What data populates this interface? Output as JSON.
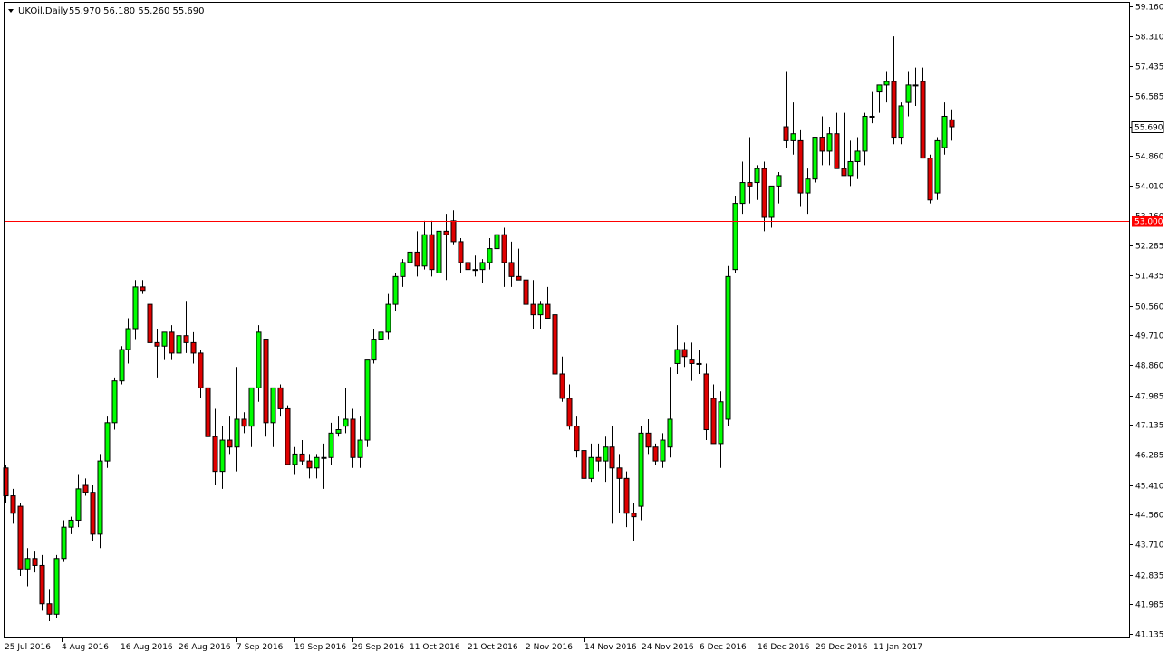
{
  "header": {
    "symbol": "UKOil,Daily",
    "ohlc": "55.970 56.180 55.260 55.690"
  },
  "colors": {
    "background": "#ffffff",
    "frame": "#000000",
    "bull": "#00ff00",
    "bear": "#e00000",
    "level_line": "#ff0000",
    "price_tag_current": "#ffffff",
    "price_tag_level": "#ff0000"
  },
  "chart_data": {
    "type": "candlestick",
    "y_range": [
      41.135,
      59.16
    ],
    "y_ticks": [
      "59.160",
      "58.310",
      "57.435",
      "56.585",
      "55.690",
      "54.860",
      "54.010",
      "53.160",
      "52.285",
      "51.435",
      "50.560",
      "49.710",
      "48.860",
      "47.985",
      "47.135",
      "46.285",
      "45.410",
      "44.560",
      "43.710",
      "42.835",
      "41.985",
      "41.135"
    ],
    "x_labels": [
      "25 Jul 2016",
      "4 Aug 2016",
      "16 Aug 2016",
      "26 Aug 2016",
      "7 Sep 2016",
      "19 Sep 2016",
      "29 Sep 2016",
      "11 Oct 2016",
      "21 Oct 2016",
      "2 Nov 2016",
      "14 Nov 2016",
      "24 Nov 2016",
      "6 Dec 2016",
      "16 Dec 2016",
      "29 Dec 2016",
      "11 Jan 2017"
    ],
    "current_price": "55.690",
    "horizontal_line": "53.000",
    "candles": [
      [
        45.9,
        46.0,
        44.9,
        45.1
      ],
      [
        45.1,
        45.3,
        44.3,
        44.6
      ],
      [
        44.8,
        44.9,
        42.8,
        43.0
      ],
      [
        43.0,
        43.6,
        42.5,
        43.3
      ],
      [
        43.3,
        43.5,
        42.9,
        43.1
      ],
      [
        43.1,
        43.4,
        41.8,
        42.0
      ],
      [
        42.0,
        42.4,
        41.5,
        41.7
      ],
      [
        41.7,
        43.4,
        41.6,
        43.3
      ],
      [
        43.3,
        44.4,
        43.2,
        44.2
      ],
      [
        44.2,
        44.5,
        44.0,
        44.4
      ],
      [
        44.4,
        45.7,
        44.2,
        45.3
      ],
      [
        45.4,
        45.6,
        45.1,
        45.2
      ],
      [
        45.2,
        45.4,
        43.8,
        44.0
      ],
      [
        44.0,
        46.3,
        43.6,
        46.1
      ],
      [
        46.1,
        47.4,
        45.9,
        47.2
      ],
      [
        47.2,
        48.5,
        47.0,
        48.4
      ],
      [
        48.4,
        49.4,
        48.3,
        49.3
      ],
      [
        49.3,
        50.2,
        48.9,
        49.9
      ],
      [
        49.9,
        51.3,
        49.6,
        51.1
      ],
      [
        51.1,
        51.3,
        50.9,
        51.0
      ],
      [
        50.6,
        50.7,
        49.5,
        49.5
      ],
      [
        49.5,
        49.9,
        48.5,
        49.4
      ],
      [
        49.4,
        49.8,
        49.0,
        49.8
      ],
      [
        49.8,
        50.0,
        49.0,
        49.2
      ],
      [
        49.2,
        49.7,
        49.0,
        49.7
      ],
      [
        49.7,
        50.7,
        49.2,
        49.5
      ],
      [
        49.5,
        49.8,
        48.9,
        49.2
      ],
      [
        49.2,
        49.3,
        47.9,
        48.2
      ],
      [
        48.2,
        48.5,
        46.6,
        46.8
      ],
      [
        46.8,
        47.6,
        45.4,
        45.8
      ],
      [
        45.8,
        47.1,
        45.3,
        46.7
      ],
      [
        46.7,
        47.4,
        46.3,
        46.5
      ],
      [
        46.5,
        48.8,
        45.8,
        47.3
      ],
      [
        47.3,
        47.5,
        46.9,
        47.1
      ],
      [
        47.1,
        48.2,
        46.5,
        48.2
      ],
      [
        48.2,
        50.0,
        47.8,
        49.8
      ],
      [
        49.6,
        49.6,
        46.8,
        47.2
      ],
      [
        47.2,
        48.1,
        46.5,
        48.2
      ],
      [
        48.2,
        48.3,
        47.4,
        47.6
      ],
      [
        47.6,
        47.7,
        46.2,
        46.0
      ],
      [
        46.0,
        46.5,
        45.7,
        46.3
      ],
      [
        46.3,
        46.7,
        46.0,
        46.1
      ],
      [
        46.1,
        46.3,
        45.6,
        45.9
      ],
      [
        45.9,
        46.3,
        45.6,
        46.2
      ],
      [
        46.2,
        46.6,
        45.3,
        46.2
      ],
      [
        46.2,
        47.2,
        46.0,
        46.9
      ],
      [
        46.9,
        47.4,
        46.8,
        47.0
      ],
      [
        47.1,
        48.2,
        46.9,
        47.3
      ],
      [
        47.3,
        47.6,
        45.9,
        46.2
      ],
      [
        46.2,
        47.4,
        45.9,
        46.7
      ],
      [
        46.7,
        49.0,
        46.5,
        49.0
      ],
      [
        49.0,
        49.9,
        48.9,
        49.6
      ],
      [
        49.6,
        50.5,
        49.2,
        49.8
      ],
      [
        49.8,
        50.9,
        49.6,
        50.6
      ],
      [
        50.6,
        51.5,
        50.4,
        51.4
      ],
      [
        51.4,
        51.9,
        51.1,
        51.8
      ],
      [
        51.8,
        52.4,
        51.6,
        52.1
      ],
      [
        52.1,
        52.7,
        51.4,
        51.7
      ],
      [
        51.7,
        53.0,
        51.6,
        52.6
      ],
      [
        52.6,
        53.0,
        51.4,
        51.6
      ],
      [
        51.5,
        52.6,
        51.4,
        52.7
      ],
      [
        52.7,
        53.2,
        51.3,
        52.6
      ],
      [
        53.0,
        53.3,
        52.3,
        52.4
      ],
      [
        52.4,
        52.5,
        51.5,
        51.8
      ],
      [
        51.8,
        52.3,
        51.2,
        51.6
      ],
      [
        51.6,
        52.0,
        51.4,
        51.6
      ],
      [
        51.6,
        51.9,
        51.2,
        51.8
      ],
      [
        51.8,
        52.5,
        51.6,
        52.2
      ],
      [
        52.2,
        53.2,
        51.5,
        52.6
      ],
      [
        52.6,
        52.8,
        51.1,
        51.8
      ],
      [
        51.8,
        52.4,
        51.1,
        51.4
      ],
      [
        51.4,
        52.2,
        51.3,
        51.3
      ],
      [
        51.3,
        51.5,
        50.3,
        50.6
      ],
      [
        50.6,
        51.3,
        49.9,
        50.3
      ],
      [
        50.3,
        50.7,
        49.9,
        50.6
      ],
      [
        50.6,
        51.1,
        50.2,
        50.2
      ],
      [
        50.3,
        50.8,
        48.6,
        48.6
      ],
      [
        48.6,
        49.1,
        47.8,
        47.9
      ],
      [
        47.9,
        48.3,
        47.0,
        47.1
      ],
      [
        47.1,
        47.4,
        46.2,
        46.4
      ],
      [
        46.4,
        47.0,
        45.2,
        45.6
      ],
      [
        45.6,
        46.6,
        45.5,
        46.2
      ],
      [
        46.2,
        46.6,
        45.8,
        46.1
      ],
      [
        46.1,
        46.8,
        45.5,
        46.5
      ],
      [
        46.5,
        47.1,
        44.3,
        45.9
      ],
      [
        45.9,
        46.3,
        44.6,
        45.6
      ],
      [
        45.6,
        45.8,
        44.2,
        44.6
      ],
      [
        44.6,
        44.9,
        43.8,
        44.5
      ],
      [
        44.8,
        47.1,
        44.4,
        46.9
      ],
      [
        46.9,
        47.3,
        46.3,
        46.5
      ],
      [
        46.5,
        46.6,
        46.0,
        46.1
      ],
      [
        46.1,
        46.9,
        45.9,
        46.7
      ],
      [
        46.5,
        48.8,
        46.2,
        47.3
      ],
      [
        48.9,
        50.0,
        48.6,
        49.3
      ],
      [
        49.3,
        49.5,
        48.8,
        49.1
      ],
      [
        49.0,
        49.5,
        48.4,
        48.9
      ],
      [
        48.9,
        49.3,
        48.6,
        48.9
      ],
      [
        48.6,
        48.9,
        46.7,
        47.0
      ],
      [
        47.9,
        48.3,
        46.9,
        46.6
      ],
      [
        46.6,
        48.1,
        45.9,
        47.8
      ],
      [
        47.3,
        51.7,
        47.1,
        51.4
      ],
      [
        51.6,
        53.7,
        51.5,
        53.5
      ],
      [
        53.5,
        54.7,
        53.2,
        54.1
      ],
      [
        54.1,
        55.4,
        53.5,
        54.0
      ],
      [
        54.1,
        54.6,
        53.6,
        54.5
      ],
      [
        54.5,
        54.7,
        52.7,
        53.1
      ],
      [
        53.1,
        54.0,
        52.8,
        54.0
      ],
      [
        54.0,
        54.4,
        53.5,
        54.3
      ],
      [
        55.7,
        57.3,
        55.1,
        55.3
      ],
      [
        55.3,
        56.4,
        54.9,
        55.5
      ],
      [
        55.3,
        55.6,
        53.4,
        53.8
      ],
      [
        53.8,
        54.5,
        53.2,
        54.2
      ],
      [
        54.2,
        55.2,
        54.1,
        55.4
      ],
      [
        55.4,
        56.0,
        54.6,
        55.0
      ],
      [
        55.0,
        55.7,
        54.6,
        55.5
      ],
      [
        55.5,
        56.1,
        54.5,
        54.5
      ],
      [
        54.5,
        56.1,
        54.5,
        54.3
      ],
      [
        54.3,
        55.3,
        54.0,
        54.7
      ],
      [
        54.7,
        55.4,
        54.2,
        55.0
      ],
      [
        55.0,
        56.1,
        54.6,
        56.0
      ],
      [
        56.0,
        56.7,
        55.8,
        56.0
      ],
      [
        56.7,
        56.9,
        56.1,
        56.9
      ],
      [
        56.9,
        57.3,
        56.4,
        57.0
      ],
      [
        57.0,
        58.3,
        55.2,
        55.4
      ],
      [
        55.4,
        56.4,
        55.2,
        56.3
      ],
      [
        56.4,
        57.3,
        56.0,
        56.9
      ],
      [
        56.9,
        57.4,
        56.3,
        56.9
      ],
      [
        57.0,
        57.4,
        54.8,
        54.8
      ],
      [
        54.8,
        54.9,
        53.5,
        53.6
      ],
      [
        53.8,
        55.4,
        53.6,
        55.3
      ],
      [
        55.1,
        56.4,
        54.9,
        56.0
      ],
      [
        55.9,
        56.2,
        55.3,
        55.7
      ]
    ]
  }
}
